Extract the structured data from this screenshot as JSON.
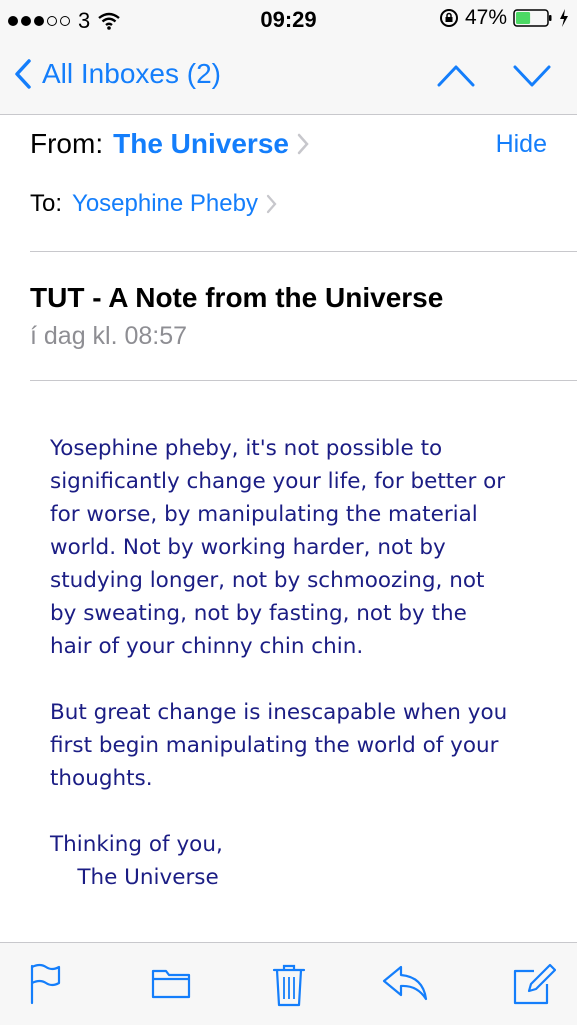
{
  "status_bar": {
    "carrier": "3",
    "time": "09:29",
    "battery_percent": "47%",
    "battery_level": 0.47,
    "battery_color": "#4cd964"
  },
  "nav": {
    "back_label": "All Inboxes (2)"
  },
  "header": {
    "from_label": "From:",
    "from_name": "The Universe",
    "hide_label": "Hide",
    "to_label": "To:",
    "to_name": "Yosephine Pheby"
  },
  "message": {
    "subject": "TUT - A Note from the Universe",
    "date": "í dag kl. 08:57",
    "body": "Yosephine pheby, it's not possible to\nsignificantly change your life, for better or\nfor worse, by manipulating the material\nworld. Not by working harder, not by\nstudying longer, not by schmoozing, not\nby sweating, not by fasting, not by the\nhair of your chinny chin chin.\n\nBut great change is inescapable when you\nfirst begin manipulating the world of your\nthoughts.\n\nThinking of you,\n    The Universe"
  },
  "toolbar": {
    "icons": [
      "flag-icon",
      "folder-icon",
      "trash-icon",
      "reply-icon",
      "compose-icon"
    ]
  },
  "colors": {
    "accent": "#147efb",
    "body_text": "#1b1d84",
    "secondary_text": "#8e8e93"
  }
}
